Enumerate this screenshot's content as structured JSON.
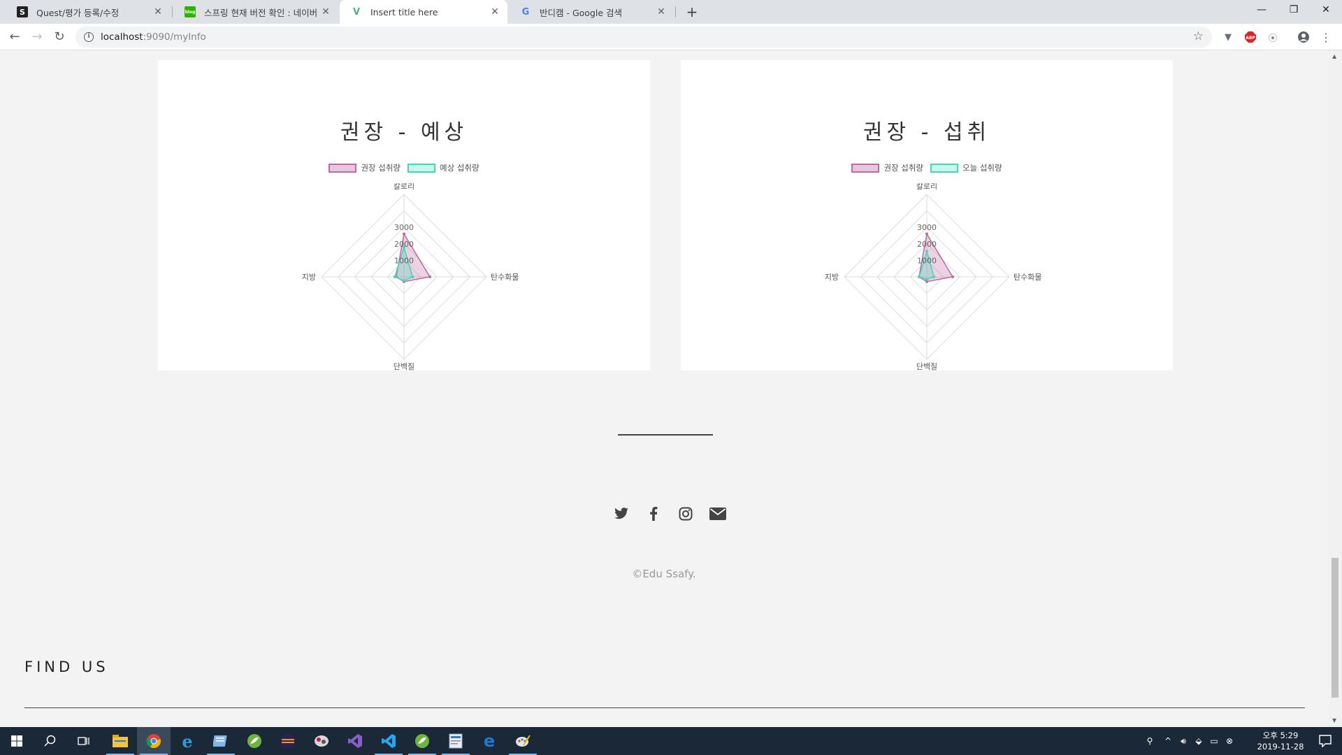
{
  "browser": {
    "tabs": [
      {
        "title": "Quest/평가 등록/수정",
        "favicon": "S"
      },
      {
        "title": "스프링 현재 버전 확인 : 네이버",
        "favicon": "blog"
      },
      {
        "title": "Insert title here",
        "favicon": "V"
      },
      {
        "title": "반디캠 - Google 검색",
        "favicon": "G"
      }
    ],
    "url_host": "localhost",
    "url_path": ":9090/myInfo",
    "extensions": [
      "vue-devtools-icon",
      "adblock-icon",
      "extension-icon",
      "profile-icon"
    ]
  },
  "cards": [
    {
      "title": "권장 - 예상",
      "legend": [
        {
          "label": "권장 섭취량",
          "fill": "#d9a3d0",
          "stroke": "#c0699e"
        },
        {
          "label": "예상 섭취량",
          "fill": "#a8f0e0",
          "stroke": "#46d6b8"
        }
      ]
    },
    {
      "title": "권장 - 섭취",
      "legend": [
        {
          "label": "권장 섭취량",
          "fill": "#d9a3d0",
          "stroke": "#c0699e"
        },
        {
          "label": "오늘 섭취량",
          "fill": "#a8f0e0",
          "stroke": "#46d6b8"
        }
      ]
    }
  ],
  "chart_data": [
    {
      "type": "radar",
      "title": "권장 - 예상",
      "axes": [
        "칼로리",
        "탄수화물",
        "단백질",
        "지방"
      ],
      "ticks": [
        "1000",
        "2000",
        "3000"
      ],
      "rmax": 5000,
      "series": [
        {
          "name": "권장 섭취량",
          "values": [
            2600,
            1570,
            290,
            470
          ],
          "color": "#c0699e"
        },
        {
          "name": "예상 섭취량",
          "values": [
            1800,
            520,
            230,
            560
          ],
          "color": "#46d6b8"
        }
      ]
    },
    {
      "type": "radar",
      "title": "권장 - 섭취",
      "axes": [
        "칼로리",
        "탄수화물",
        "단백질",
        "지방"
      ],
      "ticks": [
        "1000",
        "2000",
        "3000"
      ],
      "rmax": 5000,
      "series": [
        {
          "name": "권장 섭취량",
          "values": [
            2600,
            1570,
            290,
            470
          ],
          "color": "#c0699e"
        },
        {
          "name": "오늘 섭취량",
          "values": [
            1550,
            430,
            160,
            460
          ],
          "color": "#46d6b8"
        }
      ]
    }
  ],
  "footer": {
    "social": [
      "twitter-icon",
      "facebook-icon",
      "instagram-icon",
      "mail-icon"
    ],
    "copyright": "©Edu Ssafy.",
    "findus": "FIND US"
  },
  "taskbar": {
    "clock_time": "오후 5:29",
    "clock_date": "2019-11-28"
  }
}
